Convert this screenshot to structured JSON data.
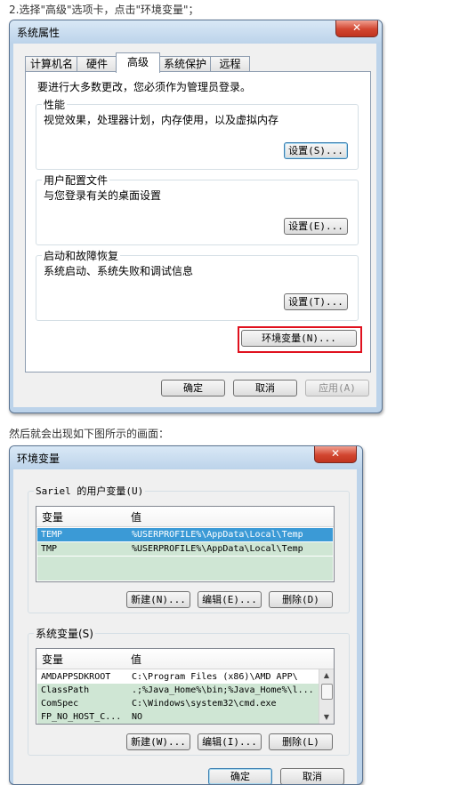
{
  "caption1": "2.选择\"高级\"选项卡，点击\"环境变量\"；",
  "caption2": "然后就会出现如下图所示的画面：",
  "sysprops": {
    "title": "系统属性",
    "close_glyph": "✕",
    "tabs": [
      {
        "label": "计算机名"
      },
      {
        "label": "硬件"
      },
      {
        "label": "高级"
      },
      {
        "label": "系统保护"
      },
      {
        "label": "远程"
      }
    ],
    "active_tab": "高级",
    "admin_notice": "要进行大多数更改，您必须作为管理员登录。",
    "performance": {
      "legend": "性能",
      "description": "视觉效果，处理器计划，内存使用，以及虚拟内存",
      "button": "设置(S)..."
    },
    "user_profiles": {
      "legend": "用户配置文件",
      "description": "与您登录有关的桌面设置",
      "button": "设置(E)..."
    },
    "startup_recovery": {
      "legend": "启动和故障恢复",
      "description": "系统启动、系统失败和调试信息",
      "button": "设置(T)..."
    },
    "env_button": "环境变量(N)...",
    "ok_button": "确定",
    "cancel_button": "取消",
    "apply_button": "应用(A)"
  },
  "envvars": {
    "title": "环境变量",
    "close_glyph": "✕",
    "user_section": {
      "legend": "Sariel 的用户变量(U)",
      "columns": [
        "变量",
        "值"
      ],
      "rows": [
        {
          "name": "TEMP",
          "value": "%USERPROFILE%\\AppData\\Local\\Temp"
        },
        {
          "name": "TMP",
          "value": "%USERPROFILE%\\AppData\\Local\\Temp"
        }
      ],
      "new_button": "新建(N)...",
      "edit_button": "编辑(E)...",
      "delete_button": "删除(D)"
    },
    "system_section": {
      "legend": "系统变量(S)",
      "columns": [
        "变量",
        "值"
      ],
      "rows": [
        {
          "name": "AMDAPPSDKROOT",
          "value": "C:\\Program Files (x86)\\AMD APP\\"
        },
        {
          "name": "ClassPath",
          "value": ".;%Java_Home%\\bin;%Java_Home%\\l..."
        },
        {
          "name": "ComSpec",
          "value": "C:\\Windows\\system32\\cmd.exe"
        },
        {
          "name": "FP_NO_HOST_C...",
          "value": "NO"
        }
      ],
      "new_button": "新建(W)...",
      "edit_button": "编辑(I)...",
      "delete_button": "删除(L)"
    },
    "ok_button": "确定",
    "cancel_button": "取消"
  },
  "colors": {
    "highlight_box": "#e0111e",
    "selected_row": "#3b9ad6",
    "row_tint": "#cfe6d4"
  }
}
